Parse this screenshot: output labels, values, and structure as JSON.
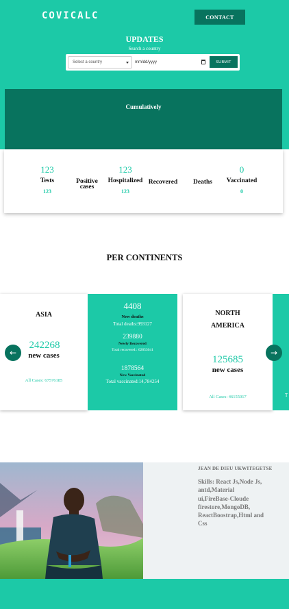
{
  "header": {
    "logo": "COVICALC",
    "contact_label": "CONTACT"
  },
  "updates": {
    "title": "UPDATES",
    "search_caption": "Search a country",
    "country_placeholder": "Select a country",
    "date_placeholder": "mm/dd/yyyy",
    "submit_label": "SUBMIT"
  },
  "cumulative": {
    "title": "Cumulatively"
  },
  "stats": [
    {
      "value": "123",
      "label": "Tests",
      "sub": "123"
    },
    {
      "value": "",
      "label": "Positive cases",
      "sub": ""
    },
    {
      "value": "123",
      "label": "Hospitalized",
      "sub": "123"
    },
    {
      "value": "",
      "label": "Recovered",
      "sub": ""
    },
    {
      "value": "",
      "label": "Deaths",
      "sub": ""
    },
    {
      "value": "0",
      "label": "Vaccinated",
      "sub": "0"
    }
  ],
  "continents_title": "PER CONTINENTS",
  "continents": [
    {
      "name": "ASIA",
      "new_cases": "242268",
      "new_cases_label": "new cases",
      "all_cases": "All Cases: 67576185",
      "deaths_num": "4408",
      "deaths_label": "New deaths",
      "total_deaths": "Total deaths:993127",
      "recovered_num": "239880",
      "recovered_label": "Newly Recovered",
      "total_recovered": "Total recovered:: 62853041",
      "vaccinated_num": "1878564",
      "vaccinated_label": "New Vaccinated",
      "total_vaccinated": "Total vaccinated:14,784254"
    },
    {
      "name": "NORTH AMERICA",
      "new_cases": "125685",
      "new_cases_label": "new cases",
      "all_cases": "All Cases: 46155017",
      "partial_text": "T"
    }
  ],
  "nav": {
    "prev_icon": "←",
    "next_icon": "→"
  },
  "author": {
    "name": "JEAN DE DIEU UKWITEGETSE",
    "skills": "Skills: React Js,Node Js, antd,Material ui,FireBase-Cloude firestore,MongoDB, ReactBoostrap,Html and Css"
  },
  "colors": {
    "accent": "#1cc9a7",
    "dark": "#08735e"
  }
}
